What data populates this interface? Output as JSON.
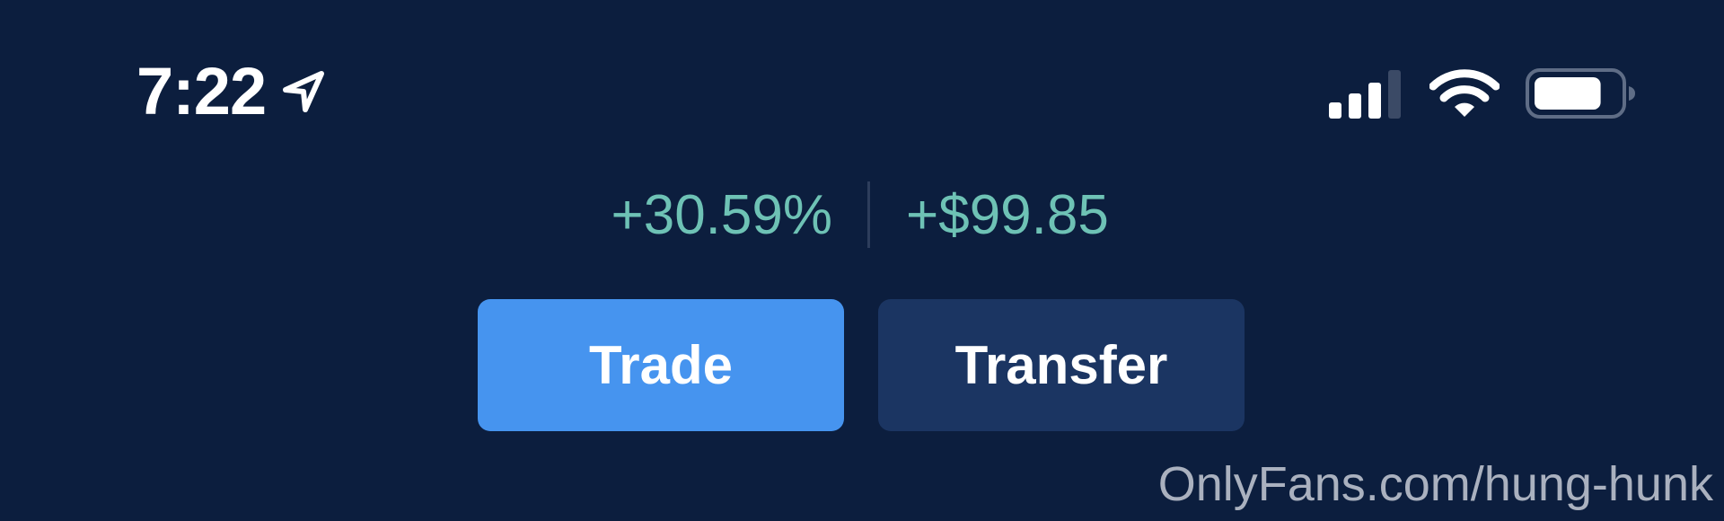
{
  "status_bar": {
    "time": "7:22",
    "icons": {
      "location": "location-arrow-icon",
      "signal": "cellular-signal-icon",
      "wifi": "wifi-icon",
      "battery": "battery-icon"
    },
    "signal_bars_filled": 3,
    "signal_bars_total": 4,
    "battery_level_percent": 80
  },
  "gains": {
    "percent": "+30.59%",
    "amount": "+$99.85",
    "color": "#6ec2b5"
  },
  "actions": {
    "trade_label": "Trade",
    "transfer_label": "Transfer",
    "trade_color": "#4694ef",
    "transfer_color": "#1b3562"
  },
  "background_color": "#0c1e3e",
  "watermark": "OnlyFans.com/hung-hunk"
}
